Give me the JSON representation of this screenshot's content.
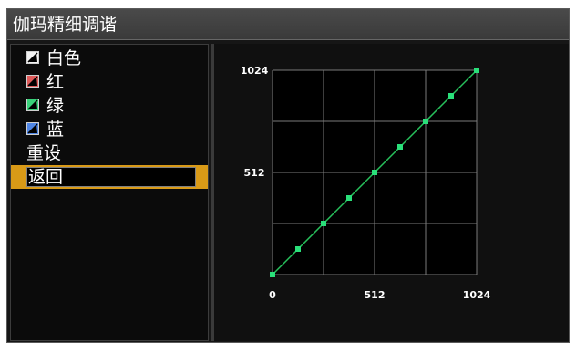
{
  "title": "伽玛精细调谐",
  "menu": {
    "items": [
      {
        "label": "白色",
        "icon": "curve-icon-white",
        "icon_color": "#f2f2f2"
      },
      {
        "label": "红",
        "icon": "curve-icon-red",
        "icon_color": "#e05a5a"
      },
      {
        "label": "绿",
        "icon": "curve-icon-green",
        "icon_color": "#39d27a"
      },
      {
        "label": "蓝",
        "icon": "curve-icon-blue",
        "icon_color": "#4f86e6"
      }
    ],
    "reset_label": "重设",
    "back_label": "返回",
    "selected": "返回",
    "highlight_color": "#d99a17"
  },
  "chart_data": {
    "type": "line",
    "title": "",
    "xlabel": "",
    "ylabel": "",
    "xlim": [
      0,
      1024
    ],
    "ylim": [
      0,
      1024
    ],
    "xticks": [
      "0",
      "512",
      "1024"
    ],
    "yticks": [
      "512",
      "1024"
    ],
    "grid": true,
    "series": [
      {
        "color": "#27c05c",
        "marker_color": "#2ae07a",
        "x": [
          0,
          128,
          256,
          384,
          512,
          640,
          768,
          896,
          1024
        ],
        "y": [
          0,
          128,
          256,
          384,
          512,
          640,
          768,
          896,
          1024
        ]
      }
    ]
  }
}
